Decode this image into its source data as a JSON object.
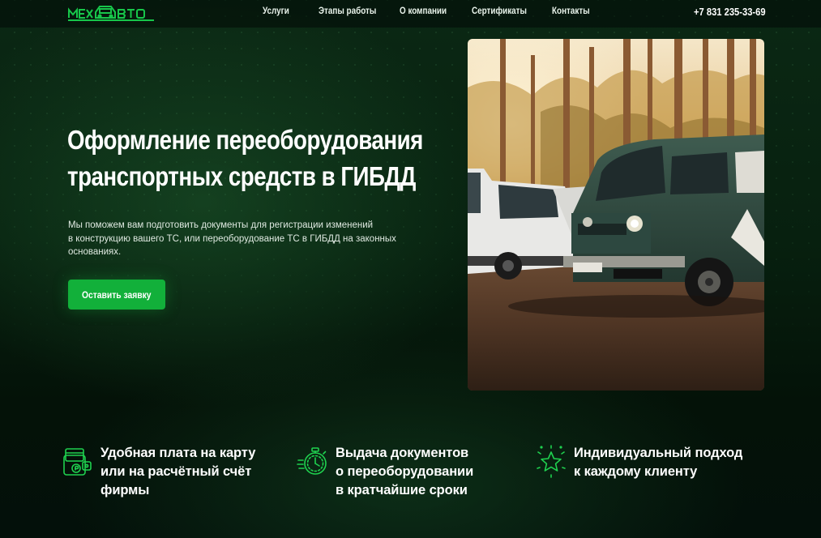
{
  "header": {
    "logo_text": "МЕХАВТО",
    "nav": [
      {
        "label": "Услуги"
      },
      {
        "label": "Этапы работы"
      },
      {
        "label": "О компании"
      },
      {
        "label": "Сертификаты"
      },
      {
        "label": "Контакты"
      }
    ],
    "phone": "+7 831 235-33-69"
  },
  "hero": {
    "title_lines": [
      "Оформление переоборудования",
      "транспортных средств в ГИБДД"
    ],
    "description_lines": [
      "Мы поможем вам подготовить документы для регистрации изменений",
      "в конструкцию вашего ТС, или переоборудование ТС в ГИБДД на законных",
      "основаниях."
    ],
    "cta_label": "Оставить заявку",
    "image_icon": "vans-in-forest-photo"
  },
  "features": [
    {
      "icon": "wallet-card-icon",
      "lines": [
        "Удобная плата на карту",
        "или на расчётный счёт",
        "фирмы"
      ]
    },
    {
      "icon": "stopwatch-icon",
      "lines": [
        "Выдача документов",
        "о переоборудовании",
        "в кратчайшие сроки"
      ]
    },
    {
      "icon": "star-sparkle-icon",
      "lines": [
        "Индивидуальный подход",
        "к каждому клиенту"
      ]
    }
  ],
  "colors": {
    "accent": "#12b03a",
    "icon_green": "#1fd14f",
    "background": "#061a0c"
  }
}
